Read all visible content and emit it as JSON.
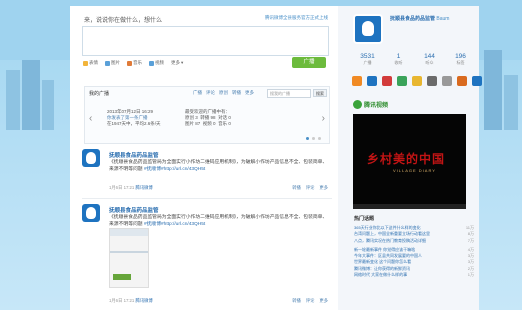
{
  "compose": {
    "label": "来，说说你在做什么，想什么",
    "hint": "腾讯微博全县服务官方正式上线",
    "tools": [
      {
        "label": "表情",
        "icon": "emoticon-icon",
        "color": "#f2b43a"
      },
      {
        "label": "图片",
        "icon": "image-icon",
        "color": "#5aa0d8"
      },
      {
        "label": "音乐",
        "icon": "music-icon",
        "color": "#e07b39"
      },
      {
        "label": "视频",
        "icon": "video-icon",
        "color": "#5aa0d8"
      },
      {
        "label": "更多",
        "icon": "more-icon",
        "color": "#999999"
      }
    ],
    "publish_label": "广播"
  },
  "broadcast": {
    "title": "我的广播",
    "tabs": [
      "广播",
      "评论",
      "原创",
      "转播",
      "更多"
    ],
    "search_placeholder": "搜我的广播",
    "search_button": "搜索",
    "col1": [
      "2013年07月12日 16:29",
      "你发表了第一条广播",
      "在1947天中，平均2.6条/天"
    ],
    "col2": [
      "最受欢迎的广播中有：",
      "原创 3",
      "转播 98",
      "对话 0",
      "图片 87",
      "视频 0",
      "音乐 0"
    ]
  },
  "posts": [
    {
      "name": "抚顺县食品药品监管",
      "text": "《抚顺县食品药品监管局为全面实行小作坊二维码应用机制》，为破解小作坊产品信息不全、包装简单、来源不明等问题",
      "link": "#抚顺博#http://url.cn/43QH5t",
      "time": "1月6日 17:21",
      "source": "腾讯微博",
      "actions": [
        "转播",
        "评论",
        "更多"
      ]
    },
    {
      "name": "抚顺县食品药品监管",
      "text": "《抚顺县食品药品监管局为全面实行小作坊二维码应用机制》，为破解小作坊产品信息不全、包装简单、来源不明等问题",
      "link": "#抚顺博#http://url.cn/43QH5t",
      "time": "1月6日 17:21",
      "source": "腾讯微博",
      "actions": [
        "转播",
        "评论",
        "更多"
      ]
    }
  ],
  "profile": {
    "name": "抚顺县食品药品监管",
    "tag": "Baum",
    "stats": [
      {
        "n": "3531",
        "l": "广播"
      },
      {
        "n": "1",
        "l": "收听"
      },
      {
        "n": "144",
        "l": "听众"
      },
      {
        "n": "196",
        "l": "标签"
      }
    ],
    "icons": [
      "#f08a24",
      "#1e73c0",
      "#d23b3b",
      "#3aa35a",
      "#e8b630",
      "#6b6b6b",
      "#999999",
      "#d96a1f",
      "#1e73c0",
      "#2c9fd6"
    ]
  },
  "tv": {
    "label": "腾讯视频",
    "title": "乡村美的中国",
    "subtitle": "VILLAGE DIARY"
  },
  "hot": {
    "title": "热门话题",
    "items": [
      {
        "t": "365天行业你比以下这件什么样的变化",
        "c": "11万"
      },
      {
        "t": "台湾问题上，中国全新重要立场行动看这里",
        "c": "8万"
      },
      {
        "t": "八点，腾讯实况在热门教育投稿活动详细",
        "c": "7万"
      },
      {
        "t": "新一轮最新事件 你觉得应该干嘛啥",
        "c": "4万"
      },
      {
        "t": "今年大事件：区县共同发展要的中国人",
        "c": "3万"
      },
      {
        "t": "世界最新变化 这个问题你怎么看",
        "c": "3万"
      },
      {
        "t": "腾讯微博：让你获得的新鲜资讯",
        "c": "2万"
      },
      {
        "t": "网络时代 大家在做什么样的事",
        "c": "1万"
      }
    ]
  }
}
